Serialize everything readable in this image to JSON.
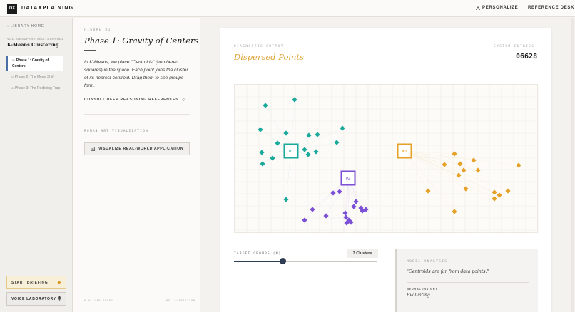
{
  "topbar": {
    "logo": "DX",
    "brand": "DATAXPLAINING",
    "personalize": "PERSONALIZE",
    "reference_desk": "REFERENCE DESK"
  },
  "sidebar": {
    "back": "LIBRARY HOME",
    "volume": "VOL. UNSUPERVISED LEARNING",
    "course": "K-Means Clustering",
    "items": [
      {
        "num": "01",
        "label": "Phase 1: Gravity of Centers"
      },
      {
        "num": "02",
        "label": "Phase 2: The Mean Shift"
      },
      {
        "num": "03",
        "label": "Phase 3: The Redlining Trap"
      }
    ],
    "start_briefing": "START BRIEFING",
    "voice_lab": "VOICE LABORATORY"
  },
  "lesson": {
    "figure": "FIGURE 01",
    "title": "Phase 1: Gravity of Centers",
    "description": "In K-Means, we place \"Centroids\" (numbered squares) in the space. Each point joins the cluster of its nearest centroid. Drag them to see groups form.",
    "consult": "CONSULT DEEP REASONING REFERENCES",
    "roman_label": "ROMAN ART VISUALIZATION",
    "visualize_button": "VISUALIZE REAL-WORLD APPLICATION",
    "footer_left": "K-01 LAB INDEX",
    "footer_right": "RE-CALIBRATION"
  },
  "output": {
    "diagnostic_label": "DIAGNOSTIC OUTPUT",
    "status": "Dispersed Points",
    "iter_label": "SYSTEM ENTRIES",
    "iter_count": "06628",
    "target_label": "TARGET GROUPS (K)",
    "clusters_badge": "3 Clusters",
    "k_fraction": 0.34
  },
  "analysis": {
    "label": "MODEL ANALYSIS",
    "text": "\"Centroids are far from data points.\"",
    "insight_label": "NEURAL INSIGHT",
    "insight_text": "Evaluating..."
  },
  "colors": {
    "teal": "#1aa99b",
    "purple": "#7b4fd6",
    "orange": "#e6a128",
    "accent": "#e0a53a"
  },
  "chart_data": {
    "type": "scatter",
    "xlim": [
      0,
      426
    ],
    "ylim": [
      0,
      209
    ],
    "centroids": [
      {
        "label": "#1",
        "x": 79,
        "y": 93,
        "color": "#1aa99b"
      },
      {
        "label": "#2",
        "x": 159,
        "y": 131,
        "color": "#7b4fd6"
      },
      {
        "label": "#3",
        "x": 238,
        "y": 93,
        "color": "#e6a128"
      }
    ],
    "series": [
      {
        "color": "#1aa99b",
        "points": [
          [
            84,
            21
          ],
          [
            43,
            29
          ],
          [
            36,
            63
          ],
          [
            60,
            82
          ],
          [
            72,
            68
          ],
          [
            104,
            71
          ],
          [
            116,
            70
          ],
          [
            151,
            61
          ],
          [
            143,
            81
          ],
          [
            38,
            95
          ],
          [
            98,
            91
          ],
          [
            53,
            103
          ],
          [
            114,
            94
          ],
          [
            103,
            98
          ],
          [
            39,
            111
          ],
          [
            72,
            161
          ]
        ]
      },
      {
        "color": "#7b4fd6",
        "points": [
          [
            138,
            152
          ],
          [
            147,
            150
          ],
          [
            170,
            164
          ],
          [
            179,
            177
          ],
          [
            109,
            175
          ],
          [
            155,
            180
          ],
          [
            177,
            173
          ],
          [
            128,
            184
          ],
          [
            98,
            190
          ],
          [
            156,
            186
          ],
          [
            184,
            175
          ],
          [
            167,
            171
          ],
          [
            160,
            190
          ],
          [
            157,
            194
          ],
          [
            163,
            193
          ]
        ]
      },
      {
        "color": "#e6a128",
        "points": [
          [
            308,
            97
          ],
          [
            294,
            112
          ],
          [
            316,
            111
          ],
          [
            321,
            120
          ],
          [
            335,
            106
          ],
          [
            314,
            127
          ],
          [
            341,
            120
          ],
          [
            398,
            113
          ],
          [
            271,
            149
          ],
          [
            324,
            146
          ],
          [
            364,
            151
          ],
          [
            371,
            155
          ],
          [
            383,
            149
          ],
          [
            364,
            160
          ],
          [
            308,
            178
          ]
        ]
      }
    ]
  }
}
